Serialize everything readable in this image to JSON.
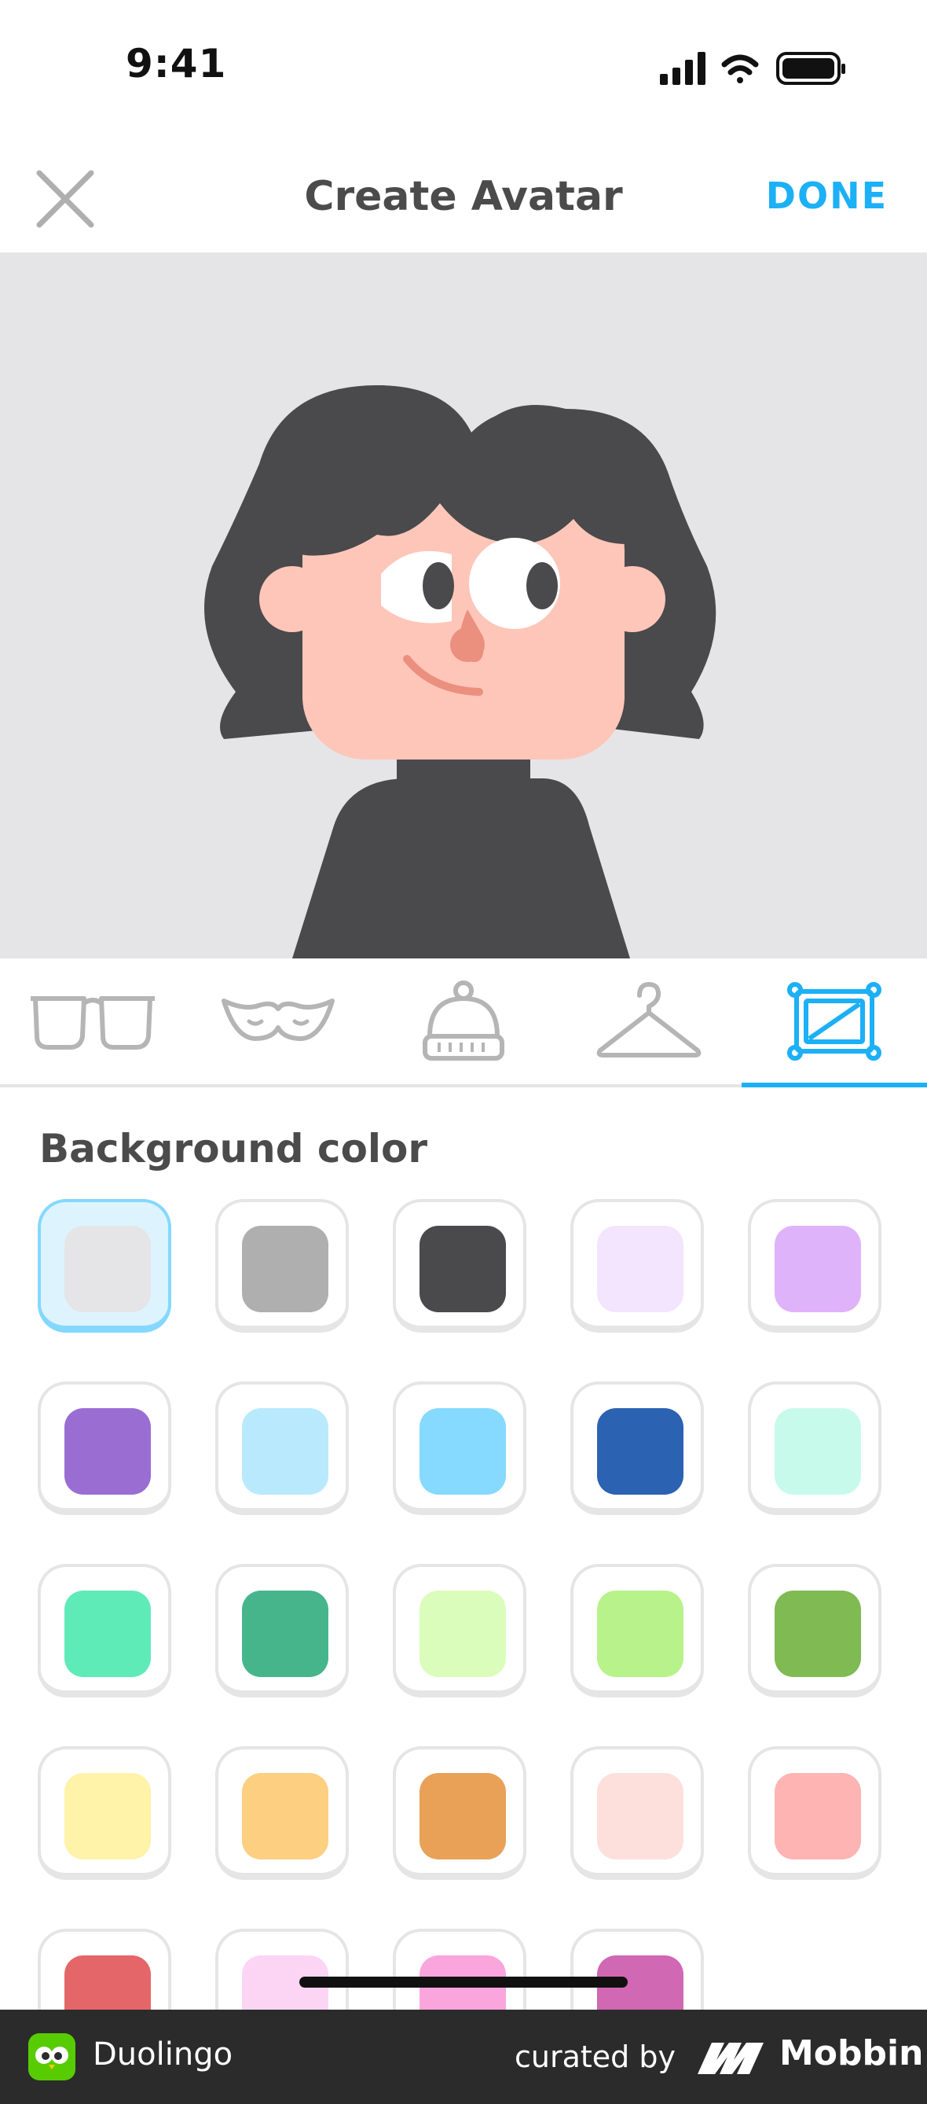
{
  "status_bar": {
    "time": "9:41"
  },
  "header": {
    "title": "Create Avatar",
    "done_label": "DONE"
  },
  "tabs": [
    {
      "name": "glasses",
      "icon": "glasses-icon"
    },
    {
      "name": "mustache",
      "icon": "mustache-icon"
    },
    {
      "name": "hat",
      "icon": "beanie-icon"
    },
    {
      "name": "clothing",
      "icon": "hanger-icon"
    },
    {
      "name": "background",
      "icon": "frame-icon",
      "active": true
    }
  ],
  "section": {
    "title": "Background color"
  },
  "colors": [
    [
      "#e5e5e7",
      "#afafb0",
      "#4a494b",
      "#f3e5fd",
      "#dfb3fa"
    ],
    [
      "#9a6dd3",
      "#b9e9fd",
      "#86d9ff",
      "#2b63b2",
      "#c8faeb"
    ],
    [
      "#5eebb8",
      "#46b58c",
      "#dafdbb",
      "#b8f28b",
      "#7fba53"
    ],
    [
      "#fff2a9",
      "#fccf81",
      "#e8a157",
      "#fde0dc",
      "#feb4b3"
    ],
    [
      "#e56668",
      "#fcd5f4",
      "#fba5dd",
      "#d168b3"
    ]
  ],
  "selected_color": "#e5e5e7",
  "footer": {
    "app_name": "Duolingo",
    "curated_by": "curated by",
    "brand": "Mobbin"
  }
}
